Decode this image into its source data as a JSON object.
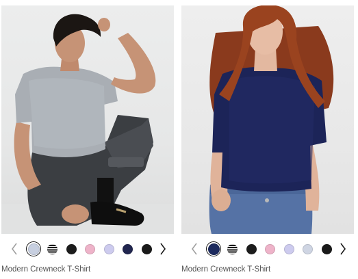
{
  "products": [
    {
      "name": "Modern Crewneck T-Shirt",
      "image_alt": "Model wearing light heather grey crewneck t-shirt with black jeans, crouching",
      "prev_icon": "chevron-left-icon",
      "next_icon": "chevron-right-icon",
      "swatches": [
        {
          "color": "#c7cfe0",
          "selected": true
        },
        {
          "color": "stripes",
          "selected": false
        },
        {
          "color": "#1c1c1c",
          "selected": false
        },
        {
          "color": "#eeb3c9",
          "selected": false
        },
        {
          "color": "#cdcbee",
          "selected": false
        },
        {
          "color": "#21264f",
          "selected": false
        },
        {
          "color": "#1a1a1a",
          "selected": false
        }
      ]
    },
    {
      "name": "Modern Crewneck T-Shirt",
      "image_alt": "Model wearing navy crewneck t-shirt with blue jeans, standing",
      "prev_icon": "chevron-left-icon",
      "next_icon": "chevron-right-icon",
      "swatches": [
        {
          "color": "#1c2a5e",
          "selected": true
        },
        {
          "color": "stripes",
          "selected": false
        },
        {
          "color": "#1c1c1c",
          "selected": false
        },
        {
          "color": "#eeb3c9",
          "selected": false
        },
        {
          "color": "#cdcbee",
          "selected": false
        },
        {
          "color": "#cfd5e3",
          "selected": false
        },
        {
          "color": "#1a1a1a",
          "selected": false
        }
      ]
    }
  ]
}
